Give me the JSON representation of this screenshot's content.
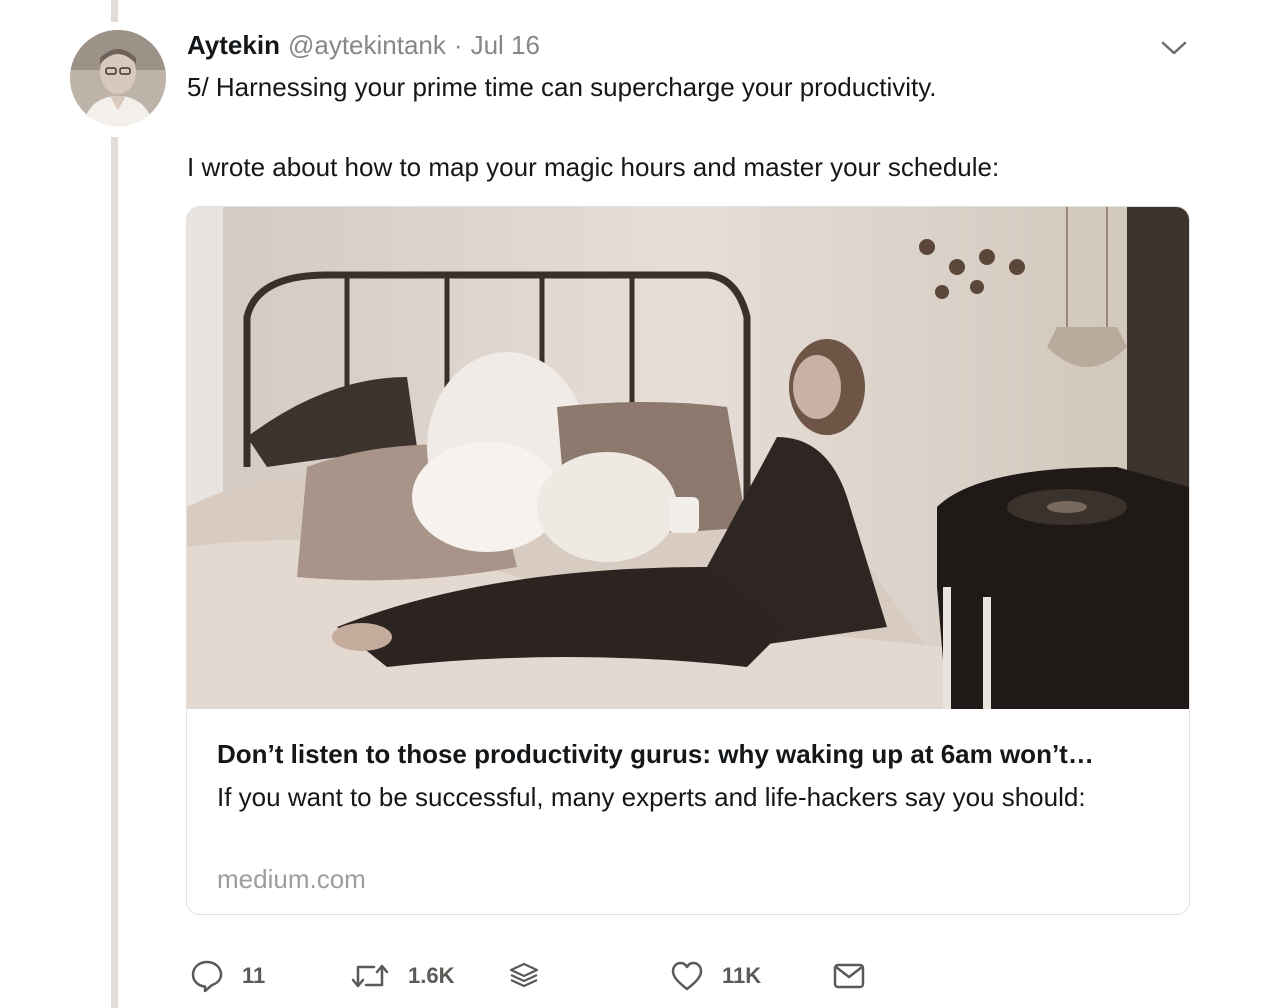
{
  "tweet": {
    "author_name": "Aytekin",
    "handle": "@aytekintank",
    "separator": "·",
    "date": "Jul 16",
    "text_line1": "5/ Harnessing your prime time can supercharge your productivity.",
    "text_line2": "I wrote about how to map your magic hours and master your schedule:"
  },
  "card": {
    "title": "Don’t listen to those productivity gurus: why waking up at 6am won’t…",
    "description": "If you want to be successful, many experts and life-hackers say you should:",
    "domain": "medium.com"
  },
  "actions": {
    "reply_count": "11",
    "retweet_count": "1.6K",
    "like_count": "11K"
  },
  "icons": {
    "reply": "reply-icon",
    "retweet": "retweet-icon",
    "layers": "layers-icon",
    "like": "heart-icon",
    "message": "envelope-icon",
    "caret": "chevron-down-icon"
  },
  "colors": {
    "text": "#14171a",
    "secondary": "#8a8684",
    "thread_line": "#e1dcd6",
    "icon": "#5c5956"
  }
}
